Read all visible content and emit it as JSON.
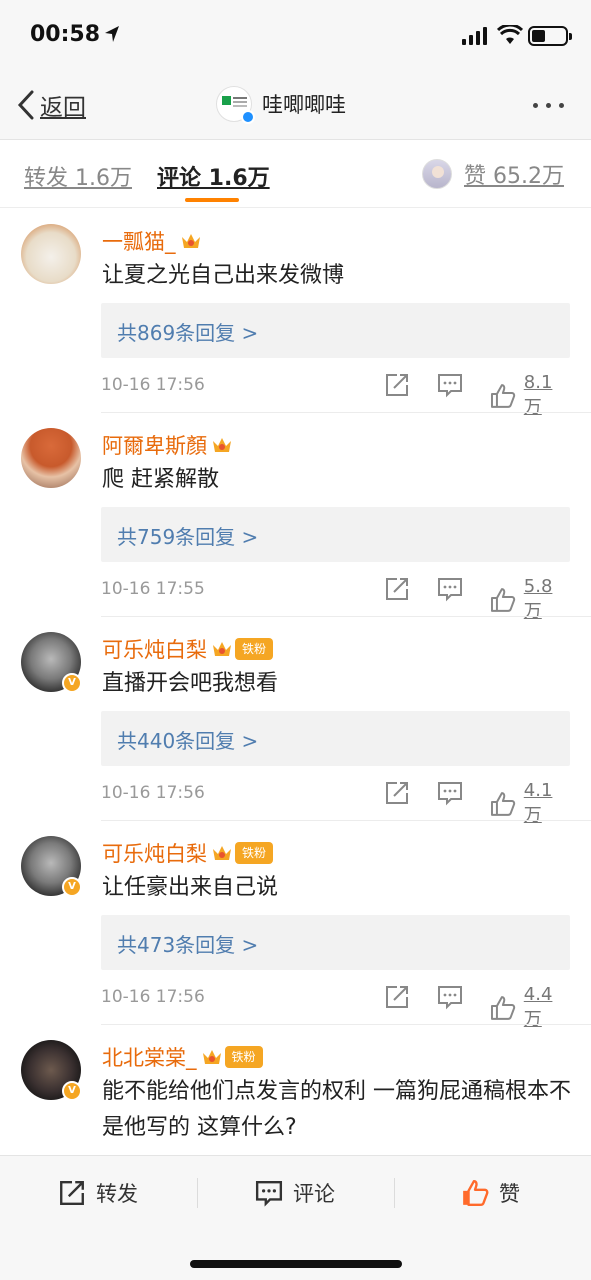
{
  "status": {
    "time": "00:58",
    "battery_level": 0.4
  },
  "nav": {
    "back_label": "返回",
    "account_name": "哇唧唧哇"
  },
  "tabs": {
    "repost": "转发 1.6万",
    "comment": "评论 1.6万",
    "likes": "赞 65.2万"
  },
  "comments": [
    {
      "name": "一瓢猫_",
      "text": "让夏之光自己出来发微博",
      "replies": "共869条回复 >",
      "time": "10-16 17:56",
      "likes": "8.1万",
      "verified": false,
      "fan_badge": ""
    },
    {
      "name": "阿爾卑斯顏",
      "text": "爬 赶紧解散",
      "replies": "共759条回复 >",
      "time": "10-16 17:55",
      "likes": "5.8万",
      "verified": false,
      "fan_badge": ""
    },
    {
      "name": "可乐炖白梨",
      "text": "直播开会吧我想看",
      "replies": "共440条回复 >",
      "time": "10-16 17:56",
      "likes": "4.1万",
      "verified": true,
      "fan_badge": "铁粉"
    },
    {
      "name": "可乐炖白梨",
      "text": "让任豪出来自己说",
      "replies": "共473条回复 >",
      "time": "10-16 17:56",
      "likes": "4.4万",
      "verified": true,
      "fan_badge": "铁粉"
    },
    {
      "name": "北北棠棠_",
      "text": "能不能给他们点发言的权利 一篇狗屁通稿根本不是他写的 这算什么?",
      "replies": "",
      "time": "",
      "likes": "",
      "verified": true,
      "fan_badge": "铁粉"
    }
  ],
  "bottom_bar": {
    "repost": "转发",
    "comment": "评论",
    "like": "赞"
  },
  "colors": {
    "accent_orange": "#ff8200",
    "username": "#e86b0c",
    "link_blue": "#507daf",
    "verified_gold": "#f5a623",
    "like_active": "#ff6a2b"
  },
  "icons": [
    "location-arrow-icon",
    "signal-icon",
    "wifi-icon",
    "battery-icon",
    "chevron-left-icon",
    "more-icon",
    "crown-icon",
    "share-icon",
    "comment-icon",
    "thumbs-up-icon"
  ]
}
